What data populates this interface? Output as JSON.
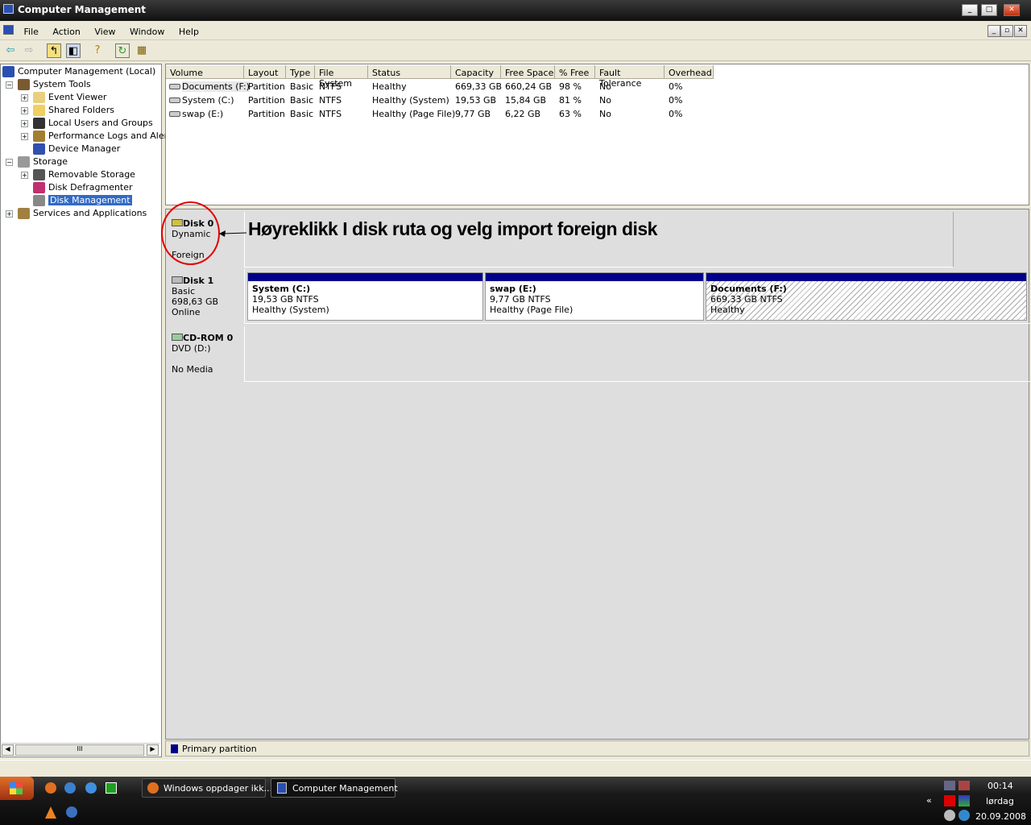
{
  "window": {
    "title": "Computer Management",
    "min": "_",
    "max": "□",
    "close": "✕"
  },
  "menu": [
    "File",
    "Action",
    "View",
    "Window",
    "Help"
  ],
  "tree": {
    "root": "Computer Management (Local)",
    "system_tools": "System Tools",
    "event_viewer": "Event Viewer",
    "shared_folders": "Shared Folders",
    "local_users": "Local Users and Groups",
    "perf_logs": "Performance Logs and Alerts",
    "device_manager": "Device Manager",
    "storage": "Storage",
    "removable": "Removable Storage",
    "defrag": "Disk Defragmenter",
    "disk_mgmt": "Disk Management",
    "services": "Services and Applications"
  },
  "list": {
    "columns": [
      "Volume",
      "Layout",
      "Type",
      "File System",
      "Status",
      "Capacity",
      "Free Space",
      "% Free",
      "Fault Tolerance",
      "Overhead"
    ],
    "rows": [
      [
        "Documents (F:)",
        "Partition",
        "Basic",
        "NTFS",
        "Healthy",
        "669,33 GB",
        "660,24 GB",
        "98 %",
        "No",
        "0%"
      ],
      [
        "System (C:)",
        "Partition",
        "Basic",
        "NTFS",
        "Healthy (System)",
        "19,53 GB",
        "15,84 GB",
        "81 %",
        "No",
        "0%"
      ],
      [
        "swap (E:)",
        "Partition",
        "Basic",
        "NTFS",
        "Healthy (Page File)",
        "9,77 GB",
        "6,22 GB",
        "63 %",
        "No",
        "0%"
      ]
    ]
  },
  "disks": {
    "disk0": {
      "name": "Disk 0",
      "type": "Dynamic",
      "status": "Foreign",
      "annotation": "Høyreklikk  I disk ruta og velg import foreign disk"
    },
    "disk1": {
      "name": "Disk 1",
      "type": "Basic",
      "size": "698,63 GB",
      "status": "Online",
      "partitions": [
        {
          "name": "System  (C:)",
          "size": "19,53 GB NTFS",
          "status": "Healthy (System)"
        },
        {
          "name": "swap  (E:)",
          "size": "9,77 GB NTFS",
          "status": "Healthy (Page File)"
        },
        {
          "name": "Documents  (F:)",
          "size": "669,33 GB NTFS",
          "status": "Healthy"
        }
      ]
    },
    "cdrom": {
      "name": "CD-ROM 0",
      "type": "DVD (D:)",
      "status": "No Media"
    }
  },
  "legend": {
    "primary": "Primary partition"
  },
  "taskbar": {
    "tasks": [
      "Windows oppdager ikk...",
      "Computer Management"
    ],
    "time": "00:14",
    "day": "lørdag",
    "date": "20.09.2008",
    "chev": "«"
  },
  "colors": {
    "primary": "#00008b",
    "selection": "#316ac5",
    "annotation_circle": "#e00000"
  }
}
